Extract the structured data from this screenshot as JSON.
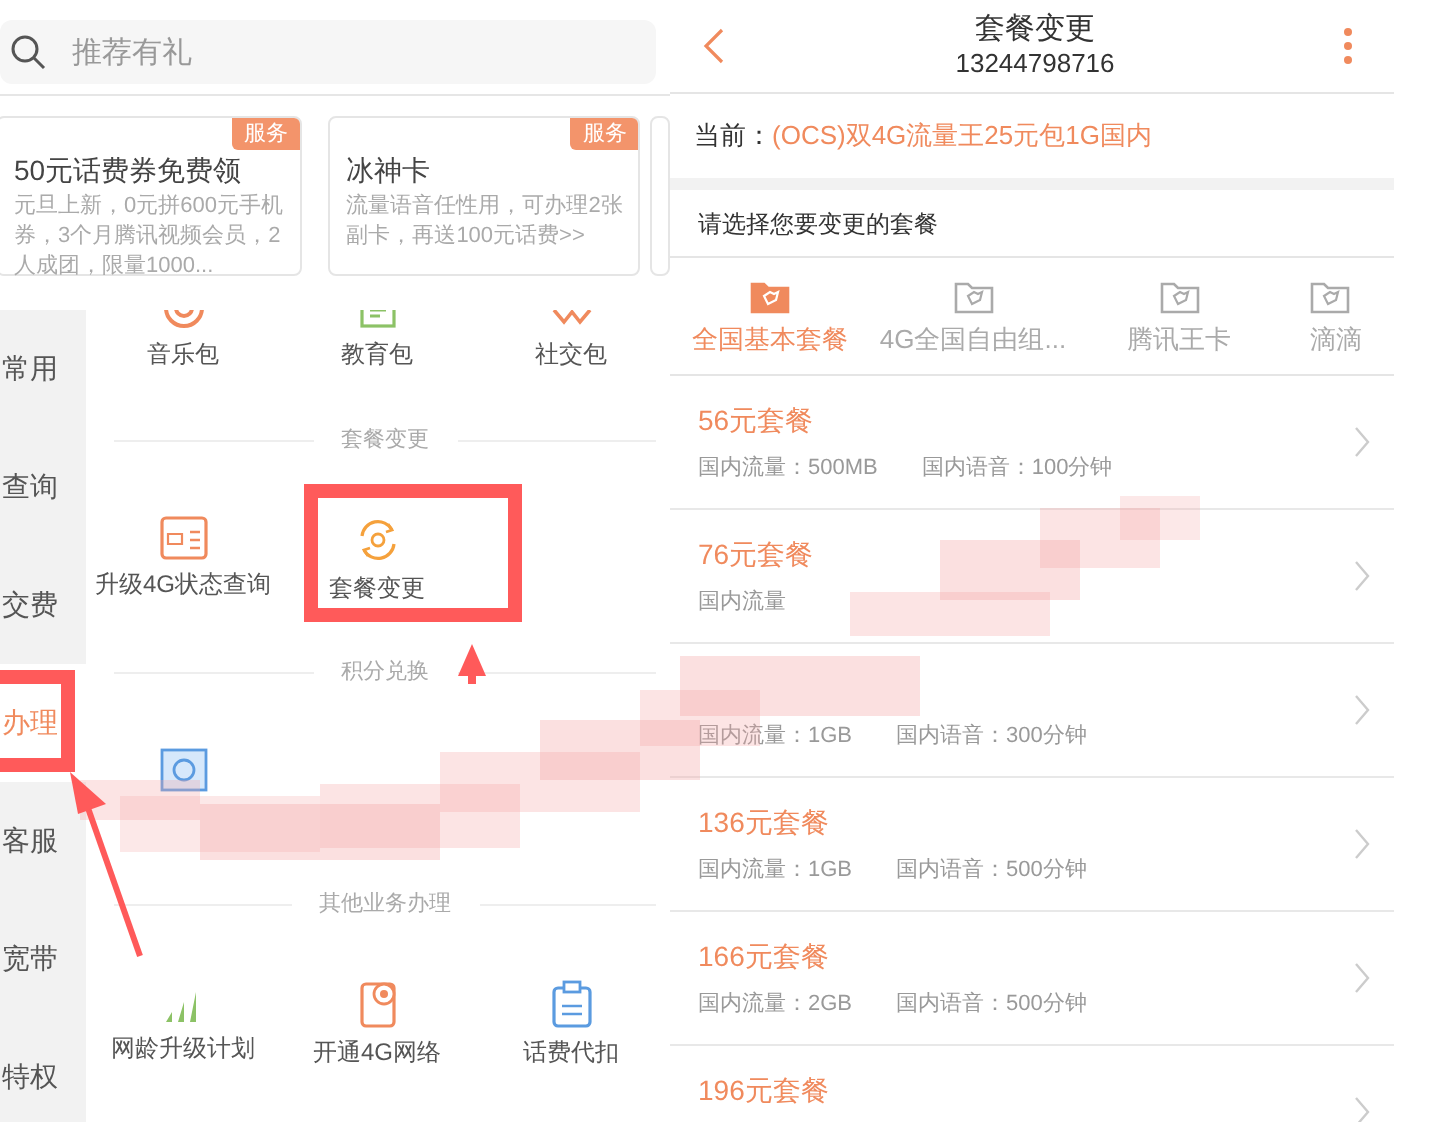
{
  "search": {
    "placeholder": "推荐有礼"
  },
  "promo_cards": [
    {
      "title": "50元话费券免费领",
      "description": "元旦上新，0元拼600元手机券，3个月腾讯视频会员，2人成团，限量1000...",
      "badge": "服务"
    },
    {
      "title": "冰神卡",
      "description": "流量语音任性用，可办理2张副卡，再送100元话费>>",
      "badge": "服务"
    }
  ],
  "sidebar": {
    "items": [
      {
        "label": "常用",
        "selected": false
      },
      {
        "label": "查询",
        "selected": false
      },
      {
        "label": "交费",
        "selected": false
      },
      {
        "label": "办理",
        "selected": true
      },
      {
        "label": "客服",
        "selected": false
      },
      {
        "label": "宽带",
        "selected": false
      },
      {
        "label": "特权",
        "selected": false
      }
    ]
  },
  "services": {
    "top_row": [
      {
        "kind": "labeled",
        "label": "音乐包"
      },
      {
        "kind": "labeled",
        "label": "教育包"
      },
      {
        "kind": "labeled",
        "label": "社交包"
      }
    ],
    "sections": [
      {
        "title": "套餐变更",
        "items": [
          {
            "kind": "labeled",
            "label": "升级4G状态查询"
          },
          {
            "kind": "labeled",
            "label": "套餐变更"
          }
        ]
      },
      {
        "title": "积分兑换",
        "items": [
          {
            "kind": "icon_only"
          }
        ]
      },
      {
        "title": "其他业务办理",
        "items": [
          {
            "kind": "labeled",
            "label": "网龄升级计划"
          },
          {
            "kind": "labeled",
            "label": "开通4G网络"
          },
          {
            "kind": "labeled",
            "label": "话费代扣"
          }
        ]
      }
    ]
  },
  "plan_change": {
    "title": "套餐变更",
    "phone": "13244798716",
    "current_label": "当前：",
    "current_plan": "(OCS)双4G流量王25元包1G国内",
    "prompt": "请选择您要变更的套餐",
    "tabs": [
      {
        "label": "全国基本套餐",
        "selected": true
      },
      {
        "label": "4G全国自由组...",
        "selected": false
      },
      {
        "label": "腾讯王卡",
        "selected": false
      },
      {
        "label": "滴滴",
        "selected": false
      }
    ],
    "plans": [
      {
        "title": "56元套餐",
        "details": [
          "国内流量：500MB",
          "国内语音：100分钟"
        ]
      },
      {
        "title": "76元套餐",
        "details": [
          "国内流量"
        ]
      },
      {
        "details": [
          "国内流量：1GB",
          "国内语音：300分钟"
        ]
      },
      {
        "title": "136元套餐",
        "details": [
          "国内流量：1GB",
          "国内语音：500分钟"
        ]
      },
      {
        "title": "166元套餐",
        "details": [
          "国内流量：2GB",
          "国内语音：500分钟"
        ]
      },
      {
        "title": "196元套餐"
      }
    ]
  }
}
